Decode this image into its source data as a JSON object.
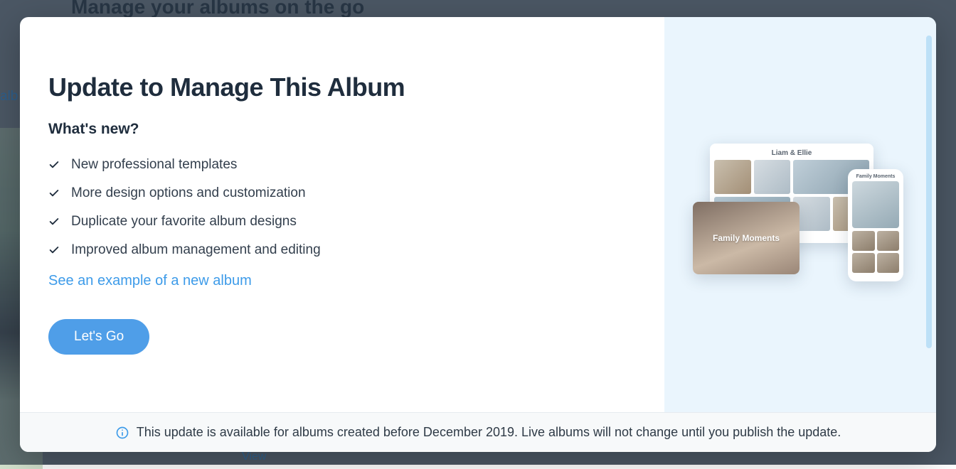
{
  "background": {
    "title": "Manage your albums on the go",
    "tab_label": "alb",
    "view_link": "View"
  },
  "modal": {
    "title": "Update to Manage This Album",
    "subtitle": "What's new?",
    "features": [
      "New professional templates",
      "More design options and customization",
      "Duplicate your favorite album designs",
      "Improved album management and editing"
    ],
    "example_link": "See an example of a new album",
    "cta": "Let's Go",
    "preview": {
      "gallery_title": "Liam & Ellie",
      "cover_title": "Family Moments",
      "phone_title": "Family Moments"
    }
  },
  "banner": {
    "text": "This update is available for albums created before December 2019. Live albums will not change until you publish the update."
  }
}
